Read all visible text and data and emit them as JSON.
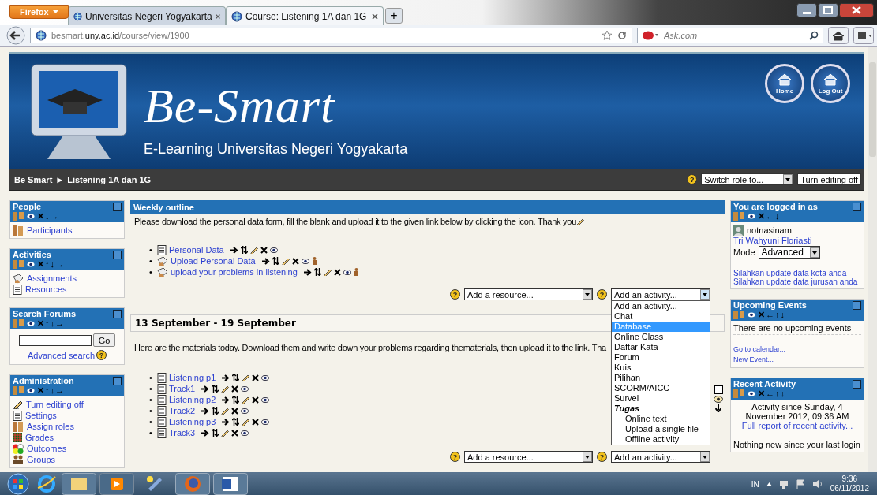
{
  "browser": {
    "menu_button": "Firefox",
    "tabs": [
      {
        "title": "Universitas Negeri Yogyakarta",
        "selected": false
      },
      {
        "title": "Course: Listening 1A dan 1G",
        "selected": true
      }
    ],
    "new_tab": "+",
    "url": "besmart.**uny.ac.id**/course/view/1900",
    "search_placeholder": "Ask.com"
  },
  "banner": {
    "title": "Be-Smart",
    "subtitle": "E-Learning Universitas Negeri Yogyakarta",
    "buttons": [
      {
        "label": "Home"
      },
      {
        "label": "Log Out"
      }
    ]
  },
  "navbar": {
    "breadcrumb": [
      "Be Smart",
      "Listening 1A dan 1G"
    ],
    "separator": "►",
    "help": "?",
    "role_select": "Switch role to...",
    "editing_button": "Turn editing off"
  },
  "left_blocks": [
    {
      "kind": "links",
      "title": "People",
      "arrows": "✕↓→",
      "items": [
        {
          "label": "Participants",
          "kind": "people"
        }
      ]
    },
    {
      "kind": "links",
      "title": "Activities",
      "arrows": "✕↑↓→",
      "items": [
        {
          "label": "Assignments",
          "kind": "assignment"
        },
        {
          "label": "Resources",
          "kind": "document"
        }
      ]
    },
    {
      "kind": "search",
      "title": "Search Forums",
      "arrows": "✕↑↓→",
      "button": "Go",
      "link": "Advanced search",
      "help": "?"
    },
    {
      "kind": "links",
      "title": "Administration",
      "arrows": "✕↑↓→",
      "items": [
        {
          "label": "Turn editing off",
          "kind": "edit"
        },
        {
          "label": "Settings",
          "kind": "document"
        },
        {
          "label": "Assign roles",
          "kind": "people"
        },
        {
          "label": "Grades",
          "kind": "grades"
        },
        {
          "label": "Outcomes",
          "kind": "outcomes"
        },
        {
          "label": "Groups",
          "kind": "groups"
        }
      ]
    }
  ],
  "sections": [
    {
      "kind": "outline",
      "bullet": "•",
      "title": "Weekly outline",
      "summary": "Please download the personal data form, fill the blank and upload it to the given link below by clicking the icon. Thank you",
      "items": [
        {
          "label": "Personal Data",
          "kind": "resource",
          "group": false
        },
        {
          "label": "Upload Personal Data",
          "kind": "assignment",
          "group": true
        },
        {
          "label": "upload your problems in listening",
          "kind": "assignment",
          "group": true
        }
      ],
      "help": "?",
      "add_resource": "Add a resource...",
      "add_activity": "Add an activity...",
      "activity_menu": [
        {
          "label": "Add an activity...",
          "kind": "option",
          "selected": false
        },
        {
          "label": "Chat",
          "kind": "option",
          "selected": false
        },
        {
          "label": "Database",
          "kind": "option",
          "selected": true
        },
        {
          "label": "Online Class",
          "kind": "option",
          "selected": false
        },
        {
          "label": "Daftar Kata",
          "kind": "option",
          "selected": false
        },
        {
          "label": "Forum",
          "kind": "option",
          "selected": false
        },
        {
          "label": "Kuis",
          "kind": "option",
          "selected": false
        },
        {
          "label": "Pilihan",
          "kind": "option",
          "selected": false
        },
        {
          "label": "SCORM/AICC",
          "kind": "option",
          "selected": false
        },
        {
          "label": "Survei",
          "kind": "option",
          "selected": false
        },
        {
          "label": "Tugas",
          "kind": "group",
          "children": [
            {
              "label": "Online text",
              "kind": "option",
              "selected": false
            },
            {
              "label": "Upload a single file",
              "kind": "option",
              "selected": false
            },
            {
              "label": "Offline activity",
              "kind": "option",
              "selected": false
            }
          ]
        }
      ]
    },
    {
      "kind": "week",
      "bullet": "•",
      "title": "13 September - 19 September",
      "summary": "Here are the materials today. Download them and write down your problems regarding thematerials, then upload it to the link. Tha",
      "items": [
        {
          "label": "Listening p1",
          "kind": "resource",
          "group": false
        },
        {
          "label": "Track1",
          "kind": "resource",
          "group": false
        },
        {
          "label": "Listening p2",
          "kind": "resource",
          "group": false
        },
        {
          "label": "Track2",
          "kind": "resource",
          "group": false
        },
        {
          "label": "Listening p3",
          "kind": "resource",
          "group": false
        },
        {
          "label": "Track3",
          "kind": "resource",
          "group": false
        }
      ],
      "help": "?",
      "add_resource": "Add a resource...",
      "add_activity": "Add an activity..."
    }
  ],
  "right_blocks": [
    {
      "kind": "login",
      "title": "You are logged in as",
      "arrows": "✕←↓",
      "username": "notnasinam",
      "fullname": "Tri Wahyuni Floriasti",
      "mode_label": "Mode",
      "mode_value": "Advanced",
      "links": [
        "Silahkan update data kota anda",
        "Silahkan update data jurusan anda"
      ]
    },
    {
      "kind": "events",
      "title": "Upcoming Events",
      "arrows": "✕←↑↓",
      "text": "There are no upcoming events",
      "links": [
        "Go to calendar...",
        "New Event..."
      ]
    },
    {
      "kind": "recent",
      "title": "Recent Activity",
      "arrows": "✕←↑↓",
      "since": "Activity since Sunday, 4 November 2012, 09:36 AM",
      "link": "Full report of recent activity...",
      "note": "Nothing new since your last login"
    }
  ],
  "taskbar": {
    "language": "IN",
    "time": "9:36",
    "date": "06/11/2012"
  }
}
